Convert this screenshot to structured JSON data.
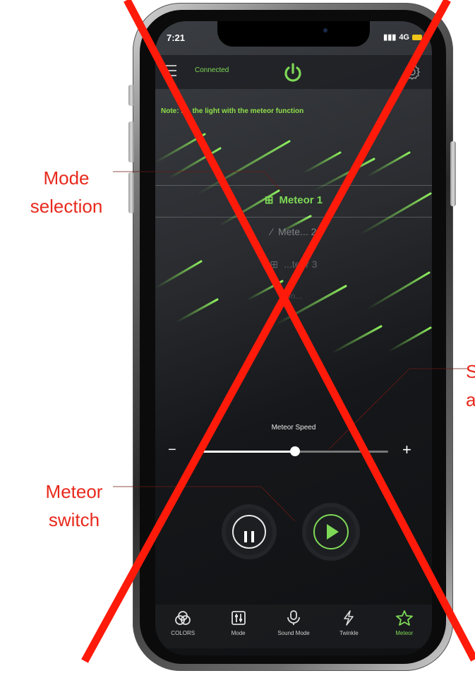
{
  "status_bar": {
    "time": "7:21",
    "network": "4G"
  },
  "top_bar": {
    "connected_label": "Connected",
    "power_icon": "power-icon",
    "settings_icon": "gear-icon",
    "menu_icon": "menu-icon"
  },
  "note": "Note: F... the light with the meteor function",
  "modes": [
    {
      "label": "Meteor 1",
      "selected": true
    },
    {
      "label": "Mete... 2",
      "selected": false
    },
    {
      "label": "...teor 3",
      "selected": false
    },
    {
      "label": "Sn...",
      "selected": false
    }
  ],
  "speed": {
    "label": "Meteor Speed",
    "minus": "−",
    "plus": "+",
    "value": 0.51
  },
  "controls": {
    "pause_icon": "pause-icon",
    "play_icon": "play-icon"
  },
  "tabs": [
    {
      "label": "COLORS",
      "icon": "colors-icon",
      "active": false
    },
    {
      "label": "Mode",
      "icon": "mode-icon",
      "active": false
    },
    {
      "label": "Sound Mode",
      "icon": "microphone-icon",
      "active": false
    },
    {
      "label": "Twinkle",
      "icon": "lightning-icon",
      "active": false
    },
    {
      "label": "Meteor",
      "icon": "star-icon",
      "active": true
    }
  ],
  "annotations": {
    "mode_selection_1": "Mode",
    "mode_selection_2": "selection",
    "meteor_switch_1": "Meteor",
    "meteor_switch_2": "switch",
    "speed_cut_1": "S",
    "speed_cut_2": "a"
  },
  "colors": {
    "accent": "#7ed957",
    "annotation": "#e8291c",
    "cross": "#ff1a0a"
  }
}
